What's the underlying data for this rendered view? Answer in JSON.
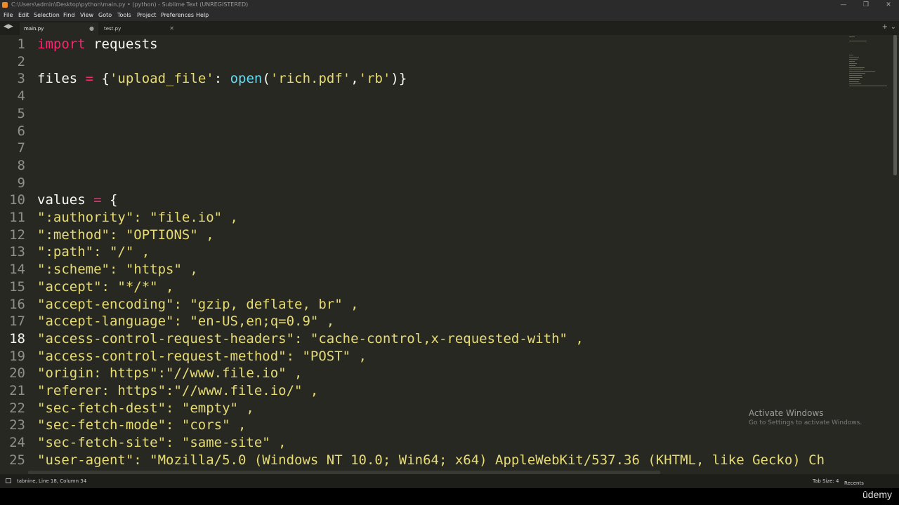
{
  "window": {
    "title": "C:\\Users\\admin\\Desktop\\python\\main.py • (python) - Sublime Text (UNREGISTERED)"
  },
  "menu": [
    "File",
    "Edit",
    "Selection",
    "Find",
    "View",
    "Goto",
    "Tools",
    "Project",
    "Preferences",
    "Help"
  ],
  "tabs": [
    {
      "label": "main.py",
      "active": true
    },
    {
      "label": "test.py",
      "active": false
    }
  ],
  "editor": {
    "current_line": 18,
    "lines": [
      {
        "n": "1",
        "tokens": [
          {
            "t": "import",
            "c": "kw"
          },
          {
            "t": " requests",
            "c": ""
          }
        ]
      },
      {
        "n": "2",
        "tokens": []
      },
      {
        "n": "3",
        "tokens": [
          {
            "t": "files ",
            "c": ""
          },
          {
            "t": "=",
            "c": "kw"
          },
          {
            "t": " {",
            "c": ""
          },
          {
            "t": "'upload_file'",
            "c": "str"
          },
          {
            "t": ": ",
            "c": ""
          },
          {
            "t": "open",
            "c": "fn"
          },
          {
            "t": "(",
            "c": ""
          },
          {
            "t": "'rich.pdf'",
            "c": "str"
          },
          {
            "t": ",",
            "c": ""
          },
          {
            "t": "'rb'",
            "c": "str"
          },
          {
            "t": ")}",
            "c": ""
          }
        ]
      },
      {
        "n": "4",
        "tokens": []
      },
      {
        "n": "5",
        "tokens": []
      },
      {
        "n": "6",
        "tokens": []
      },
      {
        "n": "7",
        "tokens": []
      },
      {
        "n": "8",
        "tokens": []
      },
      {
        "n": "9",
        "tokens": []
      },
      {
        "n": "10",
        "tokens": [
          {
            "t": "values ",
            "c": ""
          },
          {
            "t": "=",
            "c": "kw"
          },
          {
            "t": " {",
            "c": ""
          }
        ]
      },
      {
        "n": "11",
        "tokens": [
          {
            "t": "\":authority\": \"file.io\" ,",
            "c": "str"
          }
        ]
      },
      {
        "n": "12",
        "tokens": [
          {
            "t": "\":method\": \"OPTIONS\" ,",
            "c": "str"
          }
        ]
      },
      {
        "n": "13",
        "tokens": [
          {
            "t": "\":path\": \"/\" ,",
            "c": "str"
          }
        ]
      },
      {
        "n": "14",
        "tokens": [
          {
            "t": "\":scheme\": \"https\" ,",
            "c": "str"
          }
        ]
      },
      {
        "n": "15",
        "tokens": [
          {
            "t": "\"accept\": \"*/*\" ,",
            "c": "str"
          }
        ]
      },
      {
        "n": "16",
        "tokens": [
          {
            "t": "\"accept-encoding\": \"gzip, deflate, br\" ,",
            "c": "str"
          }
        ]
      },
      {
        "n": "17",
        "tokens": [
          {
            "t": "\"accept-language\": \"en-US,en;q=0.9\" ,",
            "c": "str"
          }
        ]
      },
      {
        "n": "18",
        "tokens": [
          {
            "t": "\"access-control-request-headers\": \"cache-control,x-requested-with\" ,",
            "c": "str"
          }
        ]
      },
      {
        "n": "19",
        "tokens": [
          {
            "t": "\"access-control-request-method\": \"POST\" ,",
            "c": "str"
          }
        ]
      },
      {
        "n": "20",
        "tokens": [
          {
            "t": "\"origin: https\":\"//www.file.io\" ,",
            "c": "str"
          }
        ]
      },
      {
        "n": "21",
        "tokens": [
          {
            "t": "\"referer: https\":\"//www.file.io/\" ,",
            "c": "str"
          }
        ]
      },
      {
        "n": "22",
        "tokens": [
          {
            "t": "\"sec-fetch-dest\": \"empty\" ,",
            "c": "str"
          }
        ]
      },
      {
        "n": "23",
        "tokens": [
          {
            "t": "\"sec-fetch-mode\": \"cors\" ,",
            "c": "str"
          }
        ]
      },
      {
        "n": "24",
        "tokens": [
          {
            "t": "\"sec-fetch-site\": \"same-site\" ,",
            "c": "str"
          }
        ]
      },
      {
        "n": "25",
        "tokens": [
          {
            "t": "\"user-agent\": \"Mozilla/5.0 (Windows NT 10.0; Win64; x64) AppleWebKit/537.36 (KHTML, like Gecko) Ch",
            "c": "str"
          }
        ]
      }
    ]
  },
  "watermark": {
    "line1": "Activate Windows",
    "line2": "Go to Settings to activate Windows."
  },
  "status": {
    "left": "tabnine, Line 18, Column 34",
    "tab_size": "Tab Size: 4",
    "recents": "Recents"
  },
  "branding": {
    "name": "ûdemy"
  },
  "colors": {
    "editor_bg": "#272822",
    "keyword": "#f92672",
    "string": "#e6db74",
    "function": "#66d9ef"
  }
}
